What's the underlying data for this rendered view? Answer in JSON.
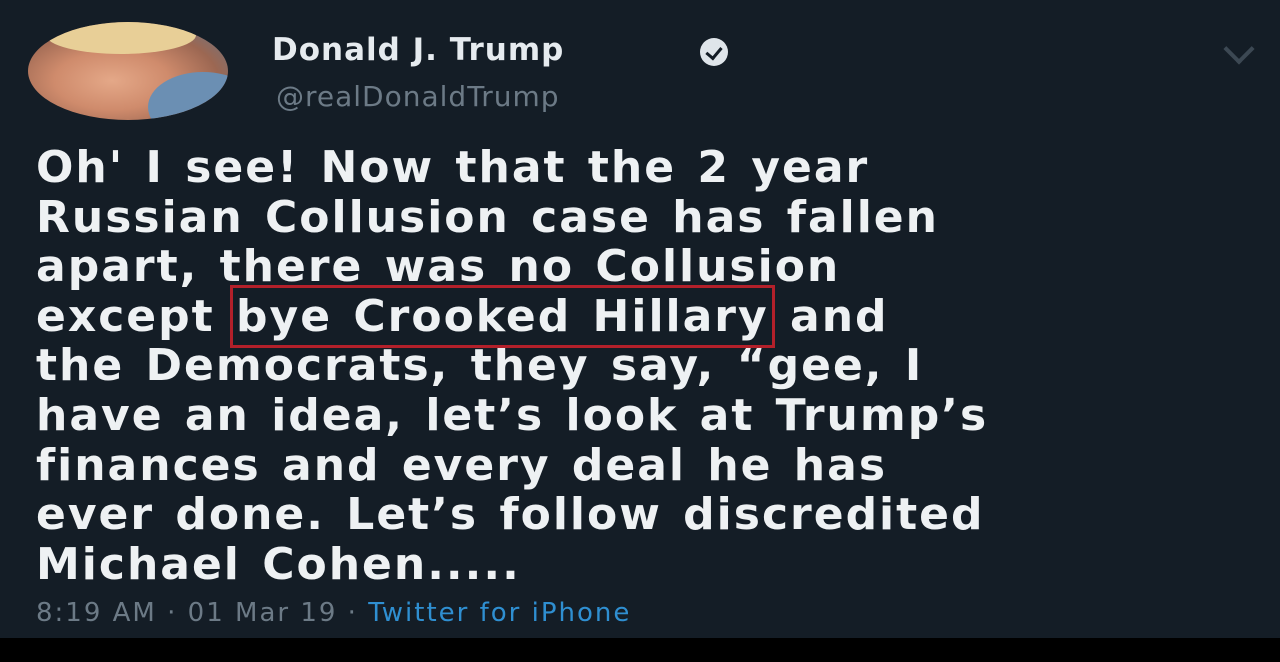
{
  "tweet": {
    "author": {
      "display_name": "Donald J. Trump",
      "handle": "@realDonaldTrump",
      "verified": true
    },
    "text_lines": [
      "Oh' I see! Now that the 2 year",
      "Russian Collusion case has fallen",
      "apart, there was no Collusion",
      "except",
      "bye Crooked Hillary",
      "and",
      "the Democrats, they say, “gee, I",
      "have an idea, let’s look at Trump’s",
      "finances and every deal he has",
      "ever done. Let’s follow discredited",
      "Michael Cohen....."
    ],
    "timestamp": "8:19 AM · 01 Mar 19 · ",
    "source": "Twitter for iPhone"
  },
  "annotation": {
    "highlight_color": "#b3202a"
  },
  "colors": {
    "card_background": "#141d26",
    "text": "#eef1f3",
    "muted": "#6c7a86",
    "link": "#2f8fd1"
  },
  "icons": {
    "verified": "verified-badge-icon",
    "menu": "chevron-down-icon"
  }
}
